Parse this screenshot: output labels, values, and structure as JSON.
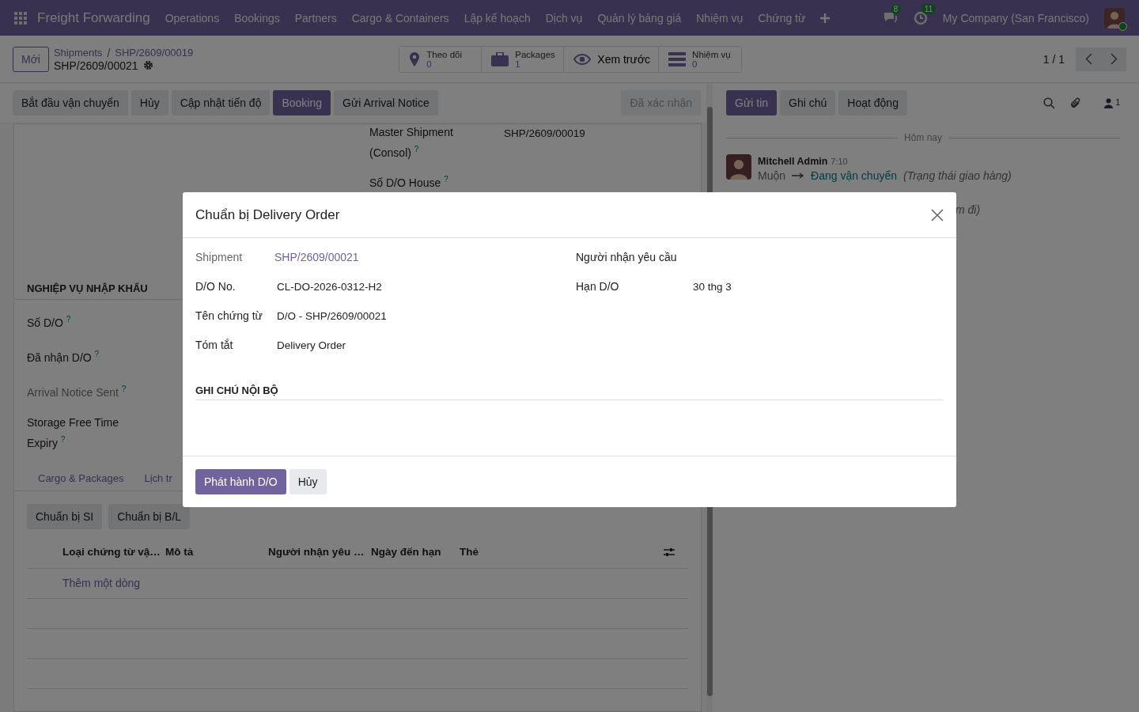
{
  "navbar": {
    "app_name": "Freight Forwarding",
    "menu": [
      "Operations",
      "Bookings",
      "Partners",
      "Cargo & Containers",
      "Lập kế hoạch",
      "Dịch vụ",
      "Quản lý bảng giá",
      "Nhiệm vụ",
      "Chứng từ"
    ],
    "messages_badge": "8",
    "activities_badge": "11",
    "company": "My Company (San Francisco)"
  },
  "control_panel": {
    "new_button": "Mới",
    "breadcrumb": [
      "Shipments",
      "SHP/2609/00019"
    ],
    "breadcrumb_separator": "/",
    "record": "SHP/2609/00021",
    "smart_buttons": [
      {
        "kind": "counter",
        "label": "Theo dõi",
        "value": "0"
      },
      {
        "kind": "counter",
        "label": "Packages",
        "value": "1"
      },
      {
        "kind": "plain",
        "label": "Xem trước"
      },
      {
        "kind": "counter",
        "label": "Nhiệm vụ",
        "value": "0"
      }
    ],
    "pager": "1 / 1"
  },
  "status_buttons": [
    {
      "label": "Bắt đầu vận chuyển",
      "primary": false
    },
    {
      "label": "Hủy",
      "primary": false
    },
    {
      "label": "Cập nhật tiến độ",
      "primary": false
    },
    {
      "label": "Booking",
      "primary": true
    },
    {
      "label": "Gửi Arrival Notice",
      "primary": false
    }
  ],
  "status_stage": "Đã xác nhận",
  "form": {
    "top_fields": [
      {
        "label": "Master Shipment (Consol)",
        "help": "?",
        "value": "SHP/2609/00019"
      },
      {
        "label": "Số D/O House",
        "help": "?"
      }
    ],
    "section": "NGHIỆP VỤ NHẬP KHẨU",
    "section_fields": [
      {
        "label": "Số D/O",
        "help": "?",
        "muted": false
      },
      {
        "label": "Đã nhận D/O",
        "help": "?",
        "muted": false
      },
      {
        "label": "Arrival Notice Sent",
        "help": "?",
        "muted": true
      },
      {
        "label": "Storage Free Time Expiry",
        "help": "?",
        "muted": false
      }
    ],
    "tabs": [
      "Cargo & Packages",
      "Lịch tr"
    ],
    "tab_buttons": [
      "Chuẩn bị SI",
      "Chuẩn bị B/L"
    ],
    "table": {
      "columns": [
        "Loại chứng từ vậ…",
        "Mô tả",
        "Người nhận yêu …",
        "Ngày đến hạn",
        "Thẻ"
      ],
      "add_line": "Thêm một dòng"
    }
  },
  "chatter": {
    "buttons": [
      {
        "label": "Gửi tin",
        "primary": true
      },
      {
        "label": "Ghi chú",
        "primary": false
      },
      {
        "label": "Hoạt động",
        "primary": false
      }
    ],
    "followers": "1",
    "date_separator": "Hôm nay",
    "message": {
      "author": "Mitchell Admin",
      "time": "7:10",
      "old_value": "Muộn",
      "new_value": "Đang vận chuyển",
      "field": "(Trạng thái giao hàng)"
    },
    "partial_line": "m đi)"
  },
  "dialog": {
    "title": "Chuẩn bị Delivery Order",
    "left_fields": [
      {
        "label": "Shipment",
        "value": "SHP/2609/00021",
        "kind": "link",
        "muted": true
      },
      {
        "label": "D/O No.",
        "value": "CL-DO-2026-0312-H2",
        "kind": "text",
        "muted": false
      },
      {
        "label": "Tên chứng từ",
        "value": "D/O - SHP/2609/00021",
        "kind": "text",
        "muted": false
      },
      {
        "label": "Tóm tắt",
        "value": "Delivery Order",
        "kind": "text",
        "muted": false
      }
    ],
    "right_fields": [
      {
        "label": "Người nhận yêu cầu",
        "kind": "empty",
        "muted": false
      },
      {
        "label": "Hạn D/O",
        "value": "30 thg 3",
        "kind": "text",
        "muted": false
      }
    ],
    "section": "GHI CHÚ NỘI BỘ",
    "buttons": [
      {
        "label": "Phát hành D/O",
        "primary": true
      },
      {
        "label": "Hủy",
        "primary": false
      }
    ]
  }
}
